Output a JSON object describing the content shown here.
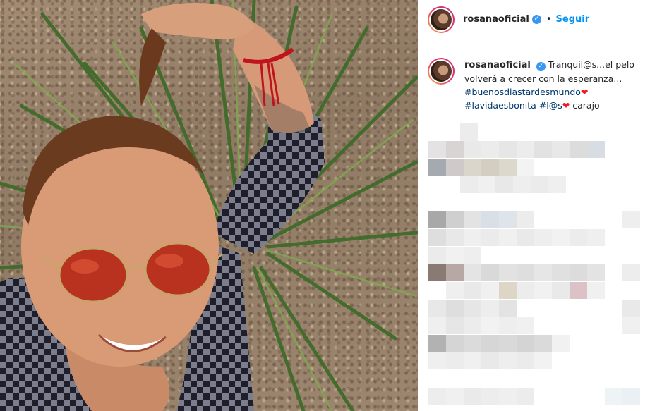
{
  "post": {
    "username": "rosanaoficial",
    "verified_mark": "✓",
    "separator": "•",
    "follow_label": "Seguir"
  },
  "caption": {
    "username": "rosanaoficial",
    "verified_mark": "✓",
    "text": " Tranquil@s...el pelo volverá a crecer con la esperanza... ",
    "hashtag1": "#buenosdiastardesmundo",
    "heart1": "❤",
    "hashtag2": "#lavidaesbonita",
    "hashtag3": "#l@s",
    "heart2": "❤",
    "tail": "carajo"
  },
  "icons": {
    "verified": "verified-badge-icon",
    "heart": "heart-icon"
  },
  "colors": {
    "follow": "#0095f6",
    "verified": "#3897f0",
    "hashtag": "#00376b",
    "heart": "#ed1c24",
    "story_ring_start": "#f9b04f",
    "story_ring_end": "#c13584"
  }
}
